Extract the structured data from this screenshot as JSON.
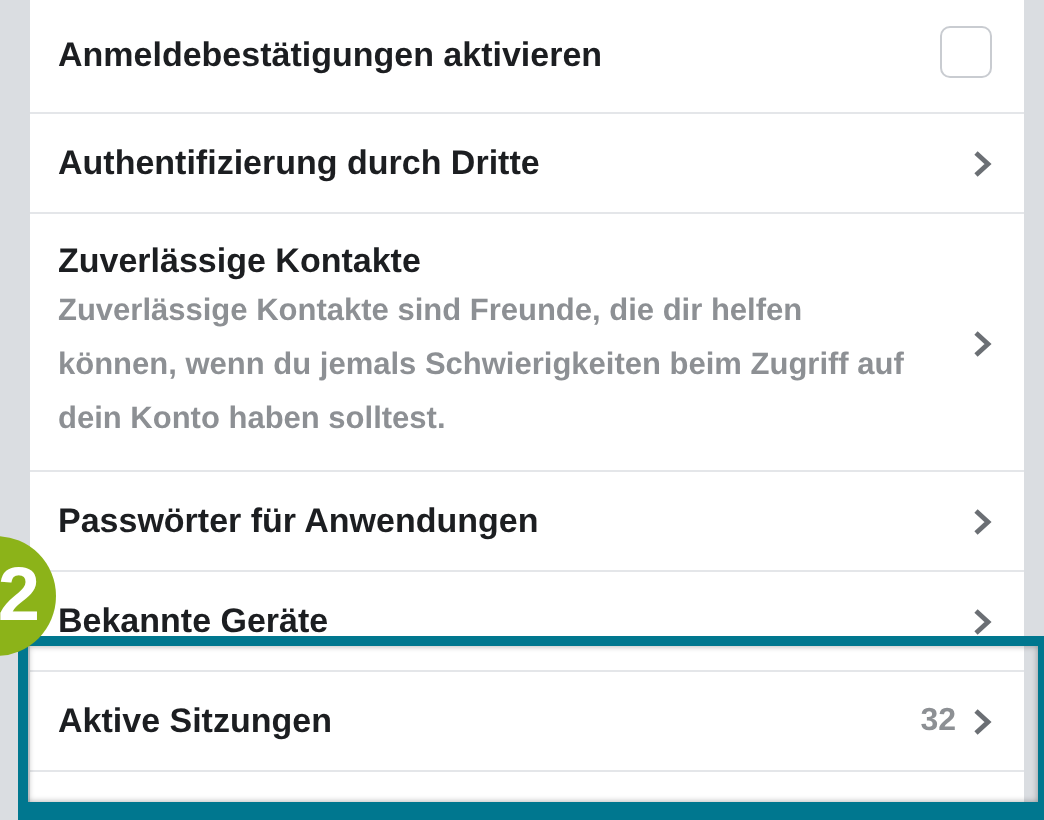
{
  "settings": [
    {
      "kind": "checkbox",
      "title": "Anmeldebestätigungen aktivieren",
      "checked": false,
      "highlighted": false
    },
    {
      "kind": "link",
      "title": "Authentifizierung durch Dritte",
      "highlighted": false
    },
    {
      "kind": "link",
      "title": "Zuverlässige Kontakte",
      "description": "Zuverlässige Kontakte sind Freunde, die dir helfen können, wenn du jemals Schwierigkeiten beim Zugriff auf dein Konto haben solltest.",
      "highlighted": false
    },
    {
      "kind": "link",
      "title": "Passwörter für Anwendungen",
      "highlighted": false
    },
    {
      "kind": "link",
      "title": "Bekannte Geräte",
      "highlighted": false
    },
    {
      "kind": "link",
      "title": "Aktive Sitzungen",
      "count": "32",
      "highlighted": true
    }
  ],
  "step_badge": {
    "text": "2"
  }
}
